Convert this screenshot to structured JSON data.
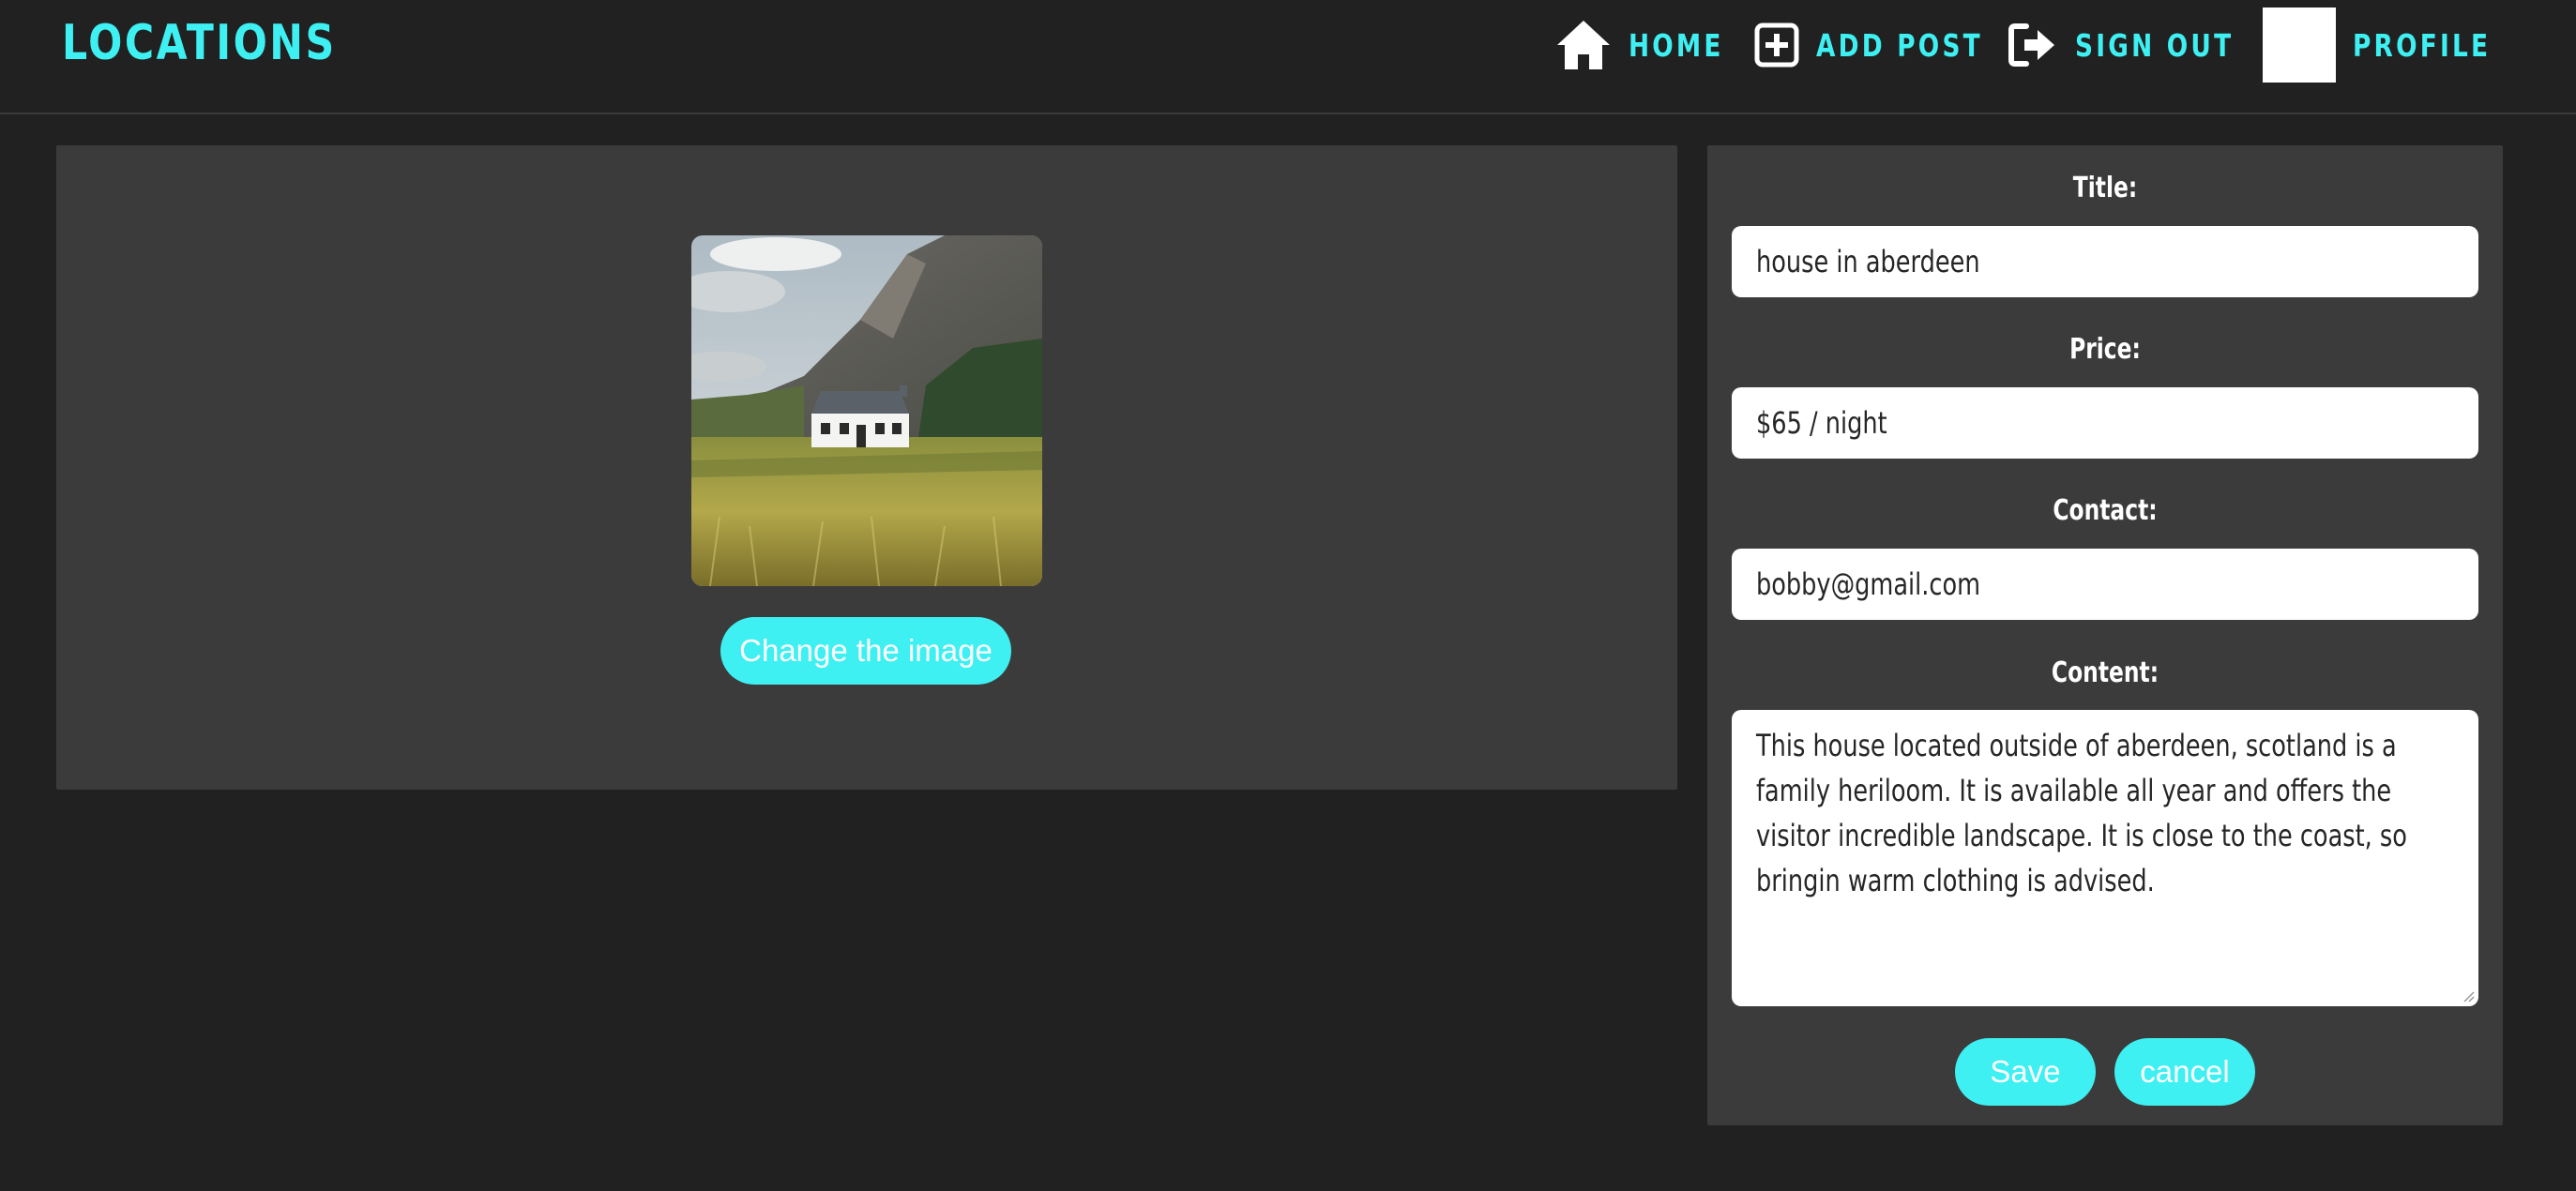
{
  "brand": "LOCATIONS",
  "nav": {
    "home": "HOME",
    "add_post": "ADD POST",
    "sign_out": "SIGN OUT",
    "profile": "PROFILE"
  },
  "icons": {
    "home": "home-icon",
    "add_post": "plus-square-icon",
    "sign_out": "sign-out-icon"
  },
  "colors": {
    "accent": "#3ef0f2",
    "background": "#212121",
    "panel": "#3b3b3b"
  },
  "image_panel": {
    "change_image_label": "Change the image"
  },
  "form": {
    "title_label": "Title:",
    "title_value": "house in aberdeen",
    "price_label": "Price:",
    "price_value": "$65 / night",
    "contact_label": "Contact:",
    "contact_value": "bobby@gmail.com",
    "content_label": "Content:",
    "content_value": "This house located outside of aberdeen, scotland is a family heriloom. It is available all year and offers the visitor incredible landscape. It is close to the coast, so bringin warm clothing is advised.",
    "save_label": "Save",
    "cancel_label": "cancel"
  }
}
